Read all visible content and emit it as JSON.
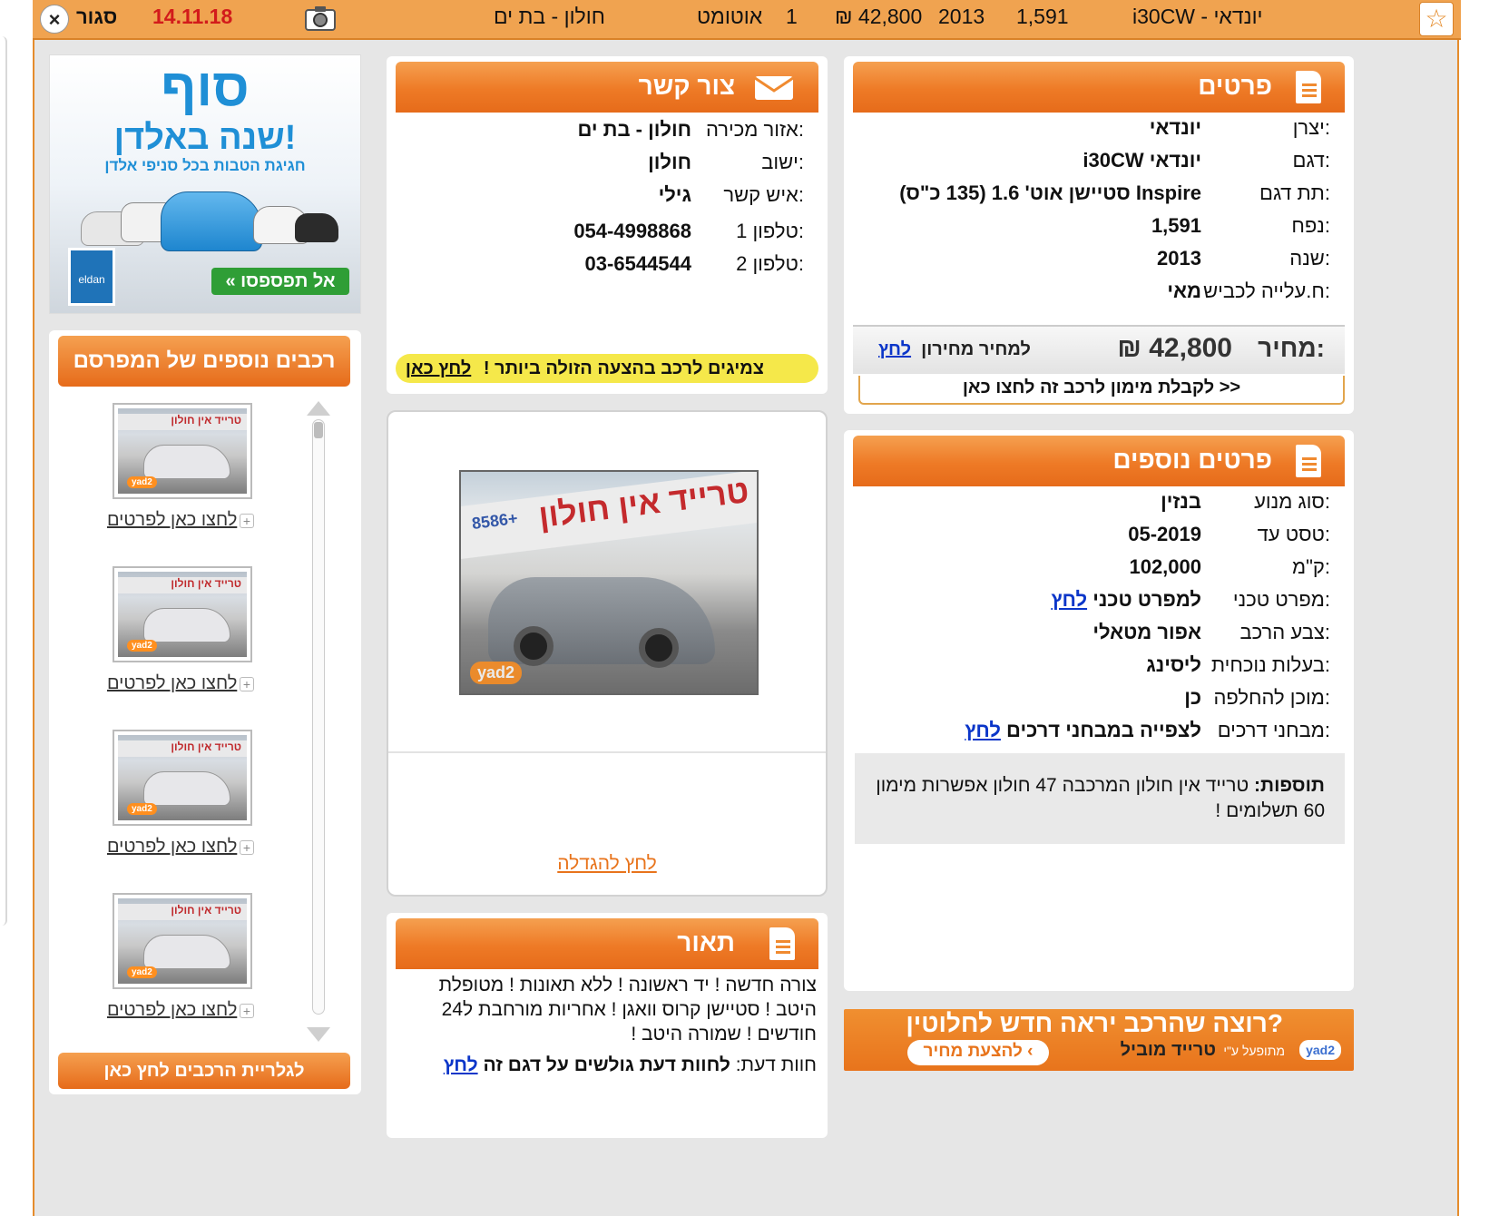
{
  "topbar": {
    "close_label": "סגור",
    "date": "14.11.18",
    "area": "חולון - בת ים",
    "gear": "אוטומט",
    "hand": "1",
    "price": "42,800 ₪",
    "year": "2013",
    "engine": "1,591",
    "model": "יונדאי - i30CW"
  },
  "details": {
    "title": "פרטים",
    "rows": [
      {
        "label": "יצרן:",
        "value": "יונדאי"
      },
      {
        "label": "דגם:",
        "value": "יונדאי i30CW"
      },
      {
        "label": "תת דגם:",
        "value": "Inspire סטיישן אוט' 1.6 (135 כ\"ס)"
      },
      {
        "label": "נפח:",
        "value": "1,591"
      },
      {
        "label": "שנה:",
        "value": "2013"
      },
      {
        "label": "ח.עלייה לכביש:",
        "value": "מאי"
      }
    ],
    "price_label": "מחיר:",
    "price_value": "42,800 ₪",
    "pricelist_text": "למחיר מחירון",
    "pricelist_link": "לחץ",
    "finance_text": "לקבלת מימון לרכב זה לחצו כאן >>"
  },
  "more_details": {
    "title": "פרטים נוספים",
    "rows": [
      {
        "label": "סוג מנוע:",
        "value": "בנזין"
      },
      {
        "label": "טסט עד:",
        "value": "05-2019"
      },
      {
        "label": "ק\"מ:",
        "value": "102,000"
      },
      {
        "label": "מפרט טכני:",
        "value": "למפרט טכני",
        "link": "לחץ"
      },
      {
        "label": "צבע הרכב:",
        "value": "אפור מטאלי"
      },
      {
        "label": "בעלות נוכחית:",
        "value": "ליסינג"
      },
      {
        "label": "מוכן להחלפה:",
        "value": "כן"
      },
      {
        "label": "מבחני דרכים:",
        "value": "לצפייה במבחני דרכים",
        "link": "לחץ"
      }
    ],
    "extras_label": "תוספות:",
    "extras_text": "טרייד אין חולון המרכבה 47 חולון אפשרות מימון 60 תשלומים !"
  },
  "contact": {
    "title": "צור קשר",
    "rows": [
      {
        "label": "אזור מכירה:",
        "value": "חולון - בת ים"
      },
      {
        "label": "ישוב:",
        "value": "חולון"
      },
      {
        "label": "איש קשר:",
        "value": "גילי"
      },
      {
        "label": "טלפון 1:",
        "value": "054-4998868"
      },
      {
        "label": "טלפון 2:",
        "value": "03-6544544"
      }
    ],
    "tires_text": "צמיגים לרכב בהצעה הזולה ביותר !",
    "tires_link": "לחץ כאן"
  },
  "photo": {
    "sign_text": "טרייד אין חולון",
    "sign_number": "8586+",
    "watermark": "yad2",
    "enlarge_link": "לחץ להגדלה"
  },
  "description": {
    "title": "תאור",
    "text": "צורה חדשה ! יד ראשונה ! ללא תאונות ! מטופלת היטב ! סטיישן קרוס וואגן ! אחריות מורחבת ל24 חודשים ! שמורה היטב !",
    "opinion_label": "חוות דעת:",
    "opinion_text": "לחוות דעת גולשים על דגם זה",
    "opinion_link": "לחץ"
  },
  "ad_banner": {
    "headline_1": "סוף",
    "headline_2": "שנה באלדן!",
    "subline": "חגיגת הטבות בכל סניפי אלדן",
    "cta": "אל תפספסו »",
    "logo": "eldan"
  },
  "sidebar": {
    "title": "רכבים נוספים של המפרסם",
    "items": [
      {
        "link": "לחצו כאן לפרטים"
      },
      {
        "link": "לחצו כאן לפרטים"
      },
      {
        "link": "לחצו כאן לפרטים"
      },
      {
        "link": "לחצו כאן לפרטים"
      }
    ],
    "thumb_sign": "טרייד אין חולון",
    "thumb_watermark": "yad2",
    "gallery_button": "לגלריית הרכבים לחץ כאן"
  },
  "trade_banner": {
    "question": "רוצה שהרכב יראה חדש לחלוטין?",
    "cta": "להצעת מחיר",
    "brand": "טרייד מוביל",
    "powered": "מתופעל ע\"י",
    "logo": "yad2"
  },
  "colors": {
    "accent": "#ee7a26",
    "link": "#0b36c9",
    "date": "#d21b1b"
  }
}
